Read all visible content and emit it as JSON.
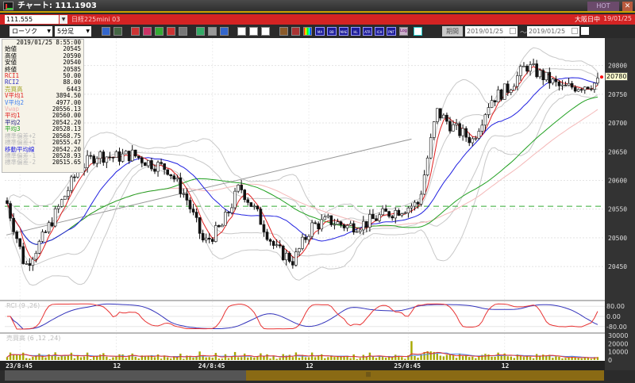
{
  "window": {
    "title": "チャート: 111.1903",
    "hot_label": "HOT",
    "close_label": "✕"
  },
  "symbol_bar": {
    "code": "111.555",
    "name": "日経225mini 03",
    "market": "大阪日中",
    "date": "19/01/25"
  },
  "toolbar": {
    "chart_type": "ローソク",
    "interval": "5分足",
    "period_label": "期間",
    "date_from": "2019/01/25",
    "date_to": "2019/01/25",
    "tilde": "～",
    "tools": [
      "zoom",
      "crosshair",
      "buy-sell",
      "target",
      "chart-fit",
      "split",
      "disabled",
      "draw",
      "pointer",
      "eraser",
      "link-left",
      "link-right",
      "all"
    ],
    "indicators": [
      "MA",
      "BB",
      "MAE",
      "HL",
      "ATR",
      "ICH",
      "PNT"
    ],
    "log_label": "Log"
  },
  "info_panel": {
    "datetime": "2019/01/25  8:55:00",
    "rows": [
      {
        "label": "始値",
        "value": "20545",
        "color": "#000"
      },
      {
        "label": "高値",
        "value": "20590",
        "color": "#000"
      },
      {
        "label": "安値",
        "value": "20540",
        "color": "#000"
      },
      {
        "label": "終値",
        "value": "20585",
        "color": "#000"
      },
      {
        "label": "RCI1",
        "value": "50.00",
        "color": "#e02020"
      },
      {
        "label": "RCI2",
        "value": "88.00",
        "color": "#3030c0"
      },
      {
        "label": "売買高",
        "value": "6443",
        "color": "#a0a020"
      },
      {
        "label": "V平均1",
        "value": "3894.50",
        "color": "#e02020"
      },
      {
        "label": "V平均2",
        "value": "4977.00",
        "color": "#4080f0"
      },
      {
        "label": "Vwap",
        "value": "20556.13",
        "color": "#f0b0b0"
      },
      {
        "label": "平均1",
        "value": "20560.00",
        "color": "#e02020"
      },
      {
        "label": "平均2",
        "value": "20542.20",
        "color": "#202080"
      },
      {
        "label": "平均3",
        "value": "20528.13",
        "color": "#20a020"
      },
      {
        "label": "標準偏差+2",
        "value": "20568.75",
        "color": "#bbb"
      },
      {
        "label": "標準偏差+1",
        "value": "20555.47",
        "color": "#bbb"
      },
      {
        "label": "移動平均線",
        "value": "20542.20",
        "color": "#2020e0"
      },
      {
        "label": "標準偏差-1",
        "value": "20528.93",
        "color": "#bbb"
      },
      {
        "label": "標準偏差-2",
        "value": "20515.65",
        "color": "#bbb"
      }
    ]
  },
  "chart_data": {
    "type": "candlestick",
    "price_axis": {
      "ticks": [
        20800,
        20750,
        20700,
        20650,
        20600,
        20550,
        20500,
        20450
      ],
      "range": [
        20395,
        20845
      ]
    },
    "current_price": "20780",
    "reference_line": 20555,
    "time_labels": [
      {
        "label": "23/8:45",
        "bar": 4
      },
      {
        "label": "12",
        "bar": 34
      },
      {
        "label": "24/8:45",
        "bar": 64
      },
      {
        "label": "12",
        "bar": 94
      },
      {
        "label": "25/8:45",
        "bar": 125
      },
      {
        "label": "12",
        "bar": 155
      }
    ],
    "close_waypoints": [
      20560,
      20450,
      20500,
      20560,
      20620,
      20645,
      20640,
      20645,
      20630,
      20620,
      20570,
      20490,
      20520,
      20590,
      20540,
      20480,
      20460,
      20520,
      20530,
      20520,
      20525,
      20540,
      20550,
      20560,
      20720,
      20690,
      20670,
      20740,
      20760,
      20800,
      20780,
      20760,
      20765,
      20770
    ],
    "bars": 185,
    "rci": {
      "title": "RCI (9 ,26)",
      "ticks": [
        "80.00",
        "0.00",
        "-80.00"
      ]
    },
    "volume": {
      "title": "売買高 (6 ,12 ,24)",
      "ticks": [
        "30000",
        "20000",
        "10000",
        "0"
      ]
    }
  },
  "colors": {
    "red": "#d42323",
    "candle": "#111",
    "ma1": "#e02020",
    "ma2": "#2020e0",
    "ma3": "#20a020",
    "bb": "#c8c8c8",
    "vol": "#a8a800"
  }
}
